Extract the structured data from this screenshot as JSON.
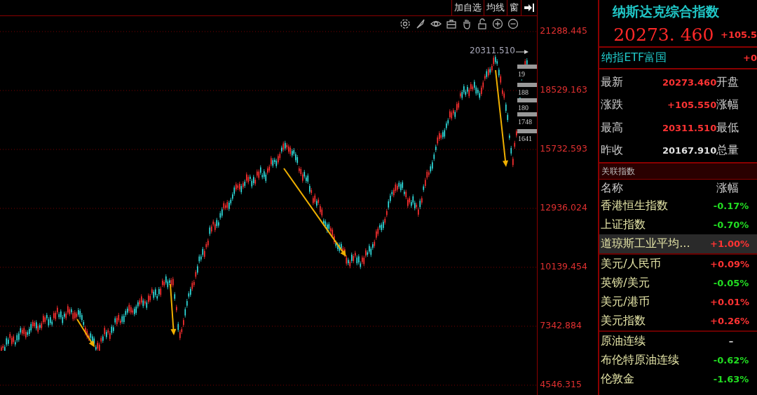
{
  "toolbar": {
    "buttons": [
      "加自选",
      "均线",
      "窗"
    ]
  },
  "chart": {
    "y_axis_labels": [
      "21288.445",
      "18529.163",
      "15732.593",
      "12936.024",
      "10139.454",
      "7342.884",
      "4546.315"
    ],
    "peak_label": "20311.510",
    "price_tags": [
      "19",
      "188",
      "180",
      "1748",
      "1641"
    ]
  },
  "quote": {
    "title": "纳斯达克综合指数",
    "price": "20273. 460",
    "change": "+105.5",
    "etf_name": "纳指ETF富国",
    "etf_change": "+0",
    "fields": [
      {
        "label": "最新",
        "value": "20273.460",
        "label_2": "开盘",
        "color": "#ff3333"
      },
      {
        "label": "涨跌",
        "value": "+105.550",
        "label_2": "涨幅",
        "color": "#ff3333"
      },
      {
        "label": "最高",
        "value": "20311.510",
        "label_2": "最低",
        "color": "#ff3333"
      },
      {
        "label": "昨收",
        "value": "20167.910",
        "label_2": "总量",
        "color": "#e0e0e0"
      }
    ]
  },
  "related": {
    "title": "关联指数",
    "columns": [
      "名称",
      "涨幅"
    ],
    "groups": [
      [
        {
          "name": "香港恒生指数",
          "change": "-0.17%",
          "color": "#22dd22",
          "selected": false
        },
        {
          "name": "上证指数",
          "change": "-0.70%",
          "color": "#22dd22",
          "selected": false
        },
        {
          "name": "道琼斯工业平均...",
          "change": "+1.00%",
          "color": "#ff3333",
          "selected": true
        }
      ],
      [
        {
          "name": "美元/人民币",
          "change": "+0.09%",
          "color": "#ff3333",
          "selected": false
        },
        {
          "name": "英镑/美元",
          "change": "-0.05%",
          "color": "#22dd22",
          "selected": false
        },
        {
          "name": "美元/港币",
          "change": "+0.01%",
          "color": "#ff3333",
          "selected": false
        },
        {
          "name": "美元指数",
          "change": "+0.26%",
          "color": "#ff3333",
          "selected": false
        }
      ],
      [
        {
          "name": "原油连续",
          "change": "–",
          "color": "#e0e0e0",
          "selected": false
        },
        {
          "name": "布伦特原油连续",
          "change": "-0.62%",
          "color": "#22dd22",
          "selected": false
        },
        {
          "name": "伦敦金",
          "change": "-1.63%",
          "color": "#22dd22",
          "selected": false
        }
      ]
    ]
  }
}
